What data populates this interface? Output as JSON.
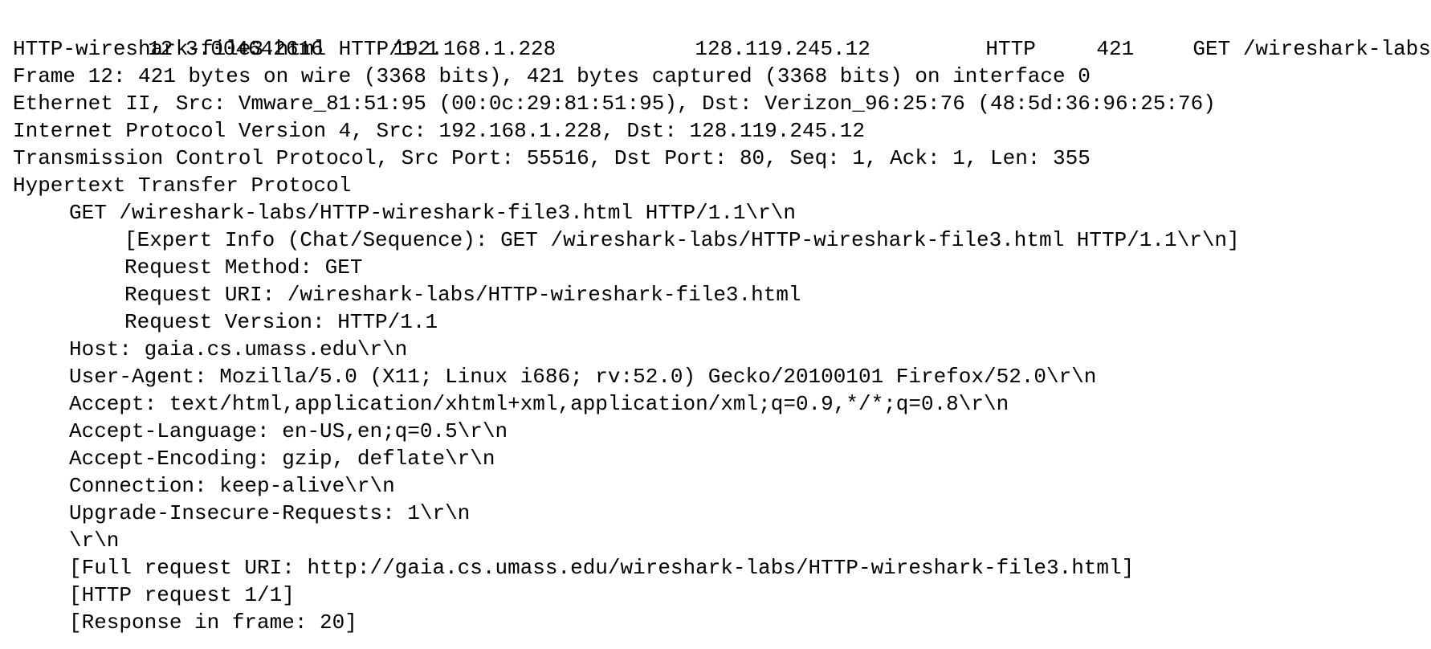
{
  "packet_summary": {
    "no": "12",
    "time": "3.004642616",
    "source": "192.168.1.228",
    "destination": "128.119.245.12",
    "protocol": "HTTP",
    "length": "421",
    "info": "GET /wireshark-labs/",
    "info_wrapped": "HTTP-wireshark-file3.html HTTP/1.1"
  },
  "details": [
    {
      "text": "Frame 12: 421 bytes on wire (3368 bits), 421 bytes captured (3368 bits) on interface 0",
      "indent": 0
    },
    {
      "text": "Ethernet II, Src: Vmware_81:51:95 (00:0c:29:81:51:95), Dst: Verizon_96:25:76 (48:5d:36:96:25:76)",
      "indent": 0
    },
    {
      "text": "Internet Protocol Version 4, Src: 192.168.1.228, Dst: 128.119.245.12",
      "indent": 0
    },
    {
      "text": "Transmission Control Protocol, Src Port: 55516, Dst Port: 80, Seq: 1, Ack: 1, Len: 355",
      "indent": 0
    },
    {
      "text": "Hypertext Transfer Protocol",
      "indent": 0
    },
    {
      "text": "GET /wireshark-labs/HTTP-wireshark-file3.html HTTP/1.1\\r\\n",
      "indent": 1
    },
    {
      "text": "[Expert Info (Chat/Sequence): GET /wireshark-labs/HTTP-wireshark-file3.html HTTP/1.1\\r\\n]",
      "indent": 2
    },
    {
      "text": "Request Method: GET",
      "indent": 2
    },
    {
      "text": "Request URI: /wireshark-labs/HTTP-wireshark-file3.html",
      "indent": 2
    },
    {
      "text": "Request Version: HTTP/1.1",
      "indent": 2
    },
    {
      "text": "Host: gaia.cs.umass.edu\\r\\n",
      "indent": 1
    },
    {
      "text": "User-Agent: Mozilla/5.0 (X11; Linux i686; rv:52.0) Gecko/20100101 Firefox/52.0\\r\\n",
      "indent": 1
    },
    {
      "text": "Accept: text/html,application/xhtml+xml,application/xml;q=0.9,*/*;q=0.8\\r\\n",
      "indent": 1
    },
    {
      "text": "Accept-Language: en-US,en;q=0.5\\r\\n",
      "indent": 1
    },
    {
      "text": "Accept-Encoding: gzip, deflate\\r\\n",
      "indent": 1
    },
    {
      "text": "Connection: keep-alive\\r\\n",
      "indent": 1
    },
    {
      "text": "Upgrade-Insecure-Requests: 1\\r\\n",
      "indent": 1
    },
    {
      "text": "\\r\\n",
      "indent": 1
    },
    {
      "text": "[Full request URI: http://gaia.cs.umass.edu/wireshark-labs/HTTP-wireshark-file3.html]",
      "indent": 1
    },
    {
      "text": "[HTTP request 1/1]",
      "indent": 1
    },
    {
      "text": "[Response in frame: 20]",
      "indent": 1
    }
  ]
}
